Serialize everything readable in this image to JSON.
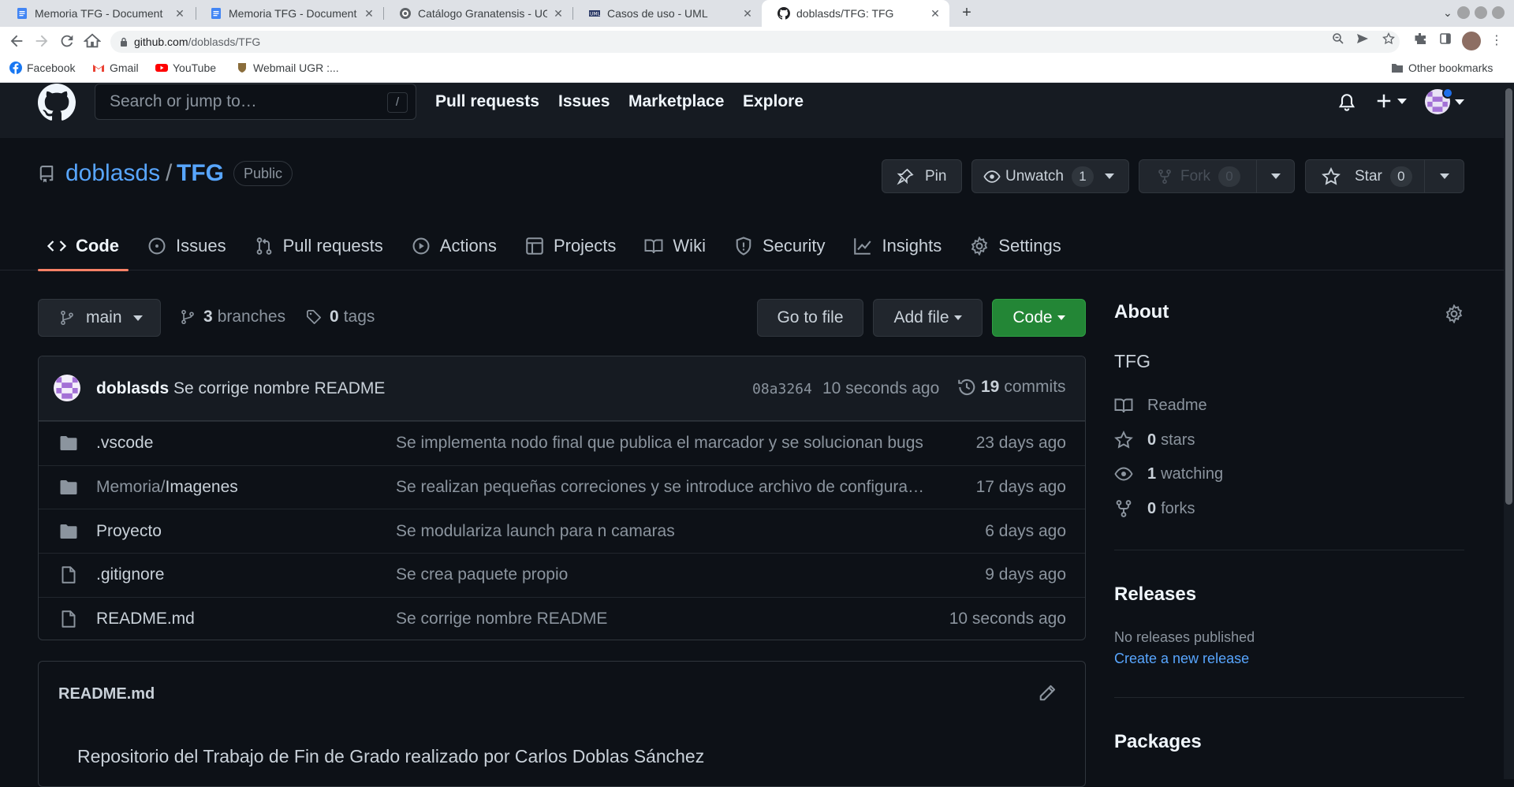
{
  "browser": {
    "tabs": [
      {
        "title": "Memoria TFG - Document",
        "icon": "google-docs-icon"
      },
      {
        "title": "Memoria TFG - Document",
        "icon": "google-docs-icon"
      },
      {
        "title": "Catálogo Granatensis - UG",
        "icon": "ugr-icon"
      },
      {
        "title": "Casos de uso - UML",
        "icon": "uml-icon"
      },
      {
        "title": "doblasds/TFG: TFG",
        "icon": "github-icon",
        "active": true
      }
    ],
    "url_host": "github.com",
    "url_path": "/doblasds/TFG",
    "bookmarks": [
      "Facebook",
      "Gmail",
      "YouTube",
      "Webmail UGR :..."
    ],
    "other_bookmarks": "Other bookmarks"
  },
  "gh": {
    "search_placeholder": "Search or jump to…",
    "search_shortcut": "/",
    "nav": [
      "Pull requests",
      "Issues",
      "Marketplace",
      "Explore"
    ]
  },
  "repo": {
    "owner": "doblasds",
    "separator": "/",
    "name": "TFG",
    "visibility": "Public",
    "pin": "Pin",
    "unwatch": "Unwatch",
    "watch_count": "1",
    "fork": "Fork",
    "fork_count": "0",
    "star": "Star",
    "star_count": "0",
    "tabs": [
      "Code",
      "Issues",
      "Pull requests",
      "Actions",
      "Projects",
      "Wiki",
      "Security",
      "Insights",
      "Settings"
    ],
    "selected_tab": "Code"
  },
  "main": {
    "branch": "main",
    "branches_count": "3",
    "branches_label": "branches",
    "tags_count": "0",
    "tags_label": "tags",
    "go_to_file": "Go to file",
    "add_file": "Add file",
    "code": "Code",
    "commit": {
      "author": "doblasds",
      "message": "Se corrige nombre README",
      "sha": "08a3264",
      "time": "10 seconds ago",
      "count": "19",
      "count_label": "commits"
    },
    "files": [
      {
        "type": "dir",
        "prefix": "",
        "name": ".vscode",
        "message": "Se implementa nodo final que publica el marcador y se solucionan bugs",
        "age": "23 days ago"
      },
      {
        "type": "dir",
        "prefix": "Memoria/",
        "name": "Imagenes",
        "message": "Se realizan pequeñas correciones y se introduce archivo de configura…",
        "age": "17 days ago"
      },
      {
        "type": "dir",
        "prefix": "",
        "name": "Proyecto",
        "message": "Se modulariza launch para n camaras",
        "age": "6 days ago"
      },
      {
        "type": "file",
        "prefix": "",
        "name": ".gitignore",
        "message": "Se crea paquete propio",
        "age": "9 days ago"
      },
      {
        "type": "file",
        "prefix": "",
        "name": "README.md",
        "message": "Se corrige nombre README",
        "age": "10 seconds ago"
      }
    ],
    "readme_title": "README.md",
    "readme_text": "Repositorio del Trabajo de Fin de Grado realizado por Carlos Doblas Sánchez"
  },
  "sidebar": {
    "about_title": "About",
    "description": "TFG",
    "readme": "Readme",
    "stars_count": "0",
    "stars_label": "stars",
    "watching_count": "1",
    "watching_label": "watching",
    "forks_count": "0",
    "forks_label": "forks",
    "releases_title": "Releases",
    "no_releases": "No releases published",
    "create_release": "Create a new release",
    "packages_title": "Packages"
  },
  "colors": {
    "bg": "#0d1117",
    "header_bg": "#161b22",
    "link": "#58a6ff",
    "code_button": "#238636",
    "tab_underline": "#f78166"
  }
}
